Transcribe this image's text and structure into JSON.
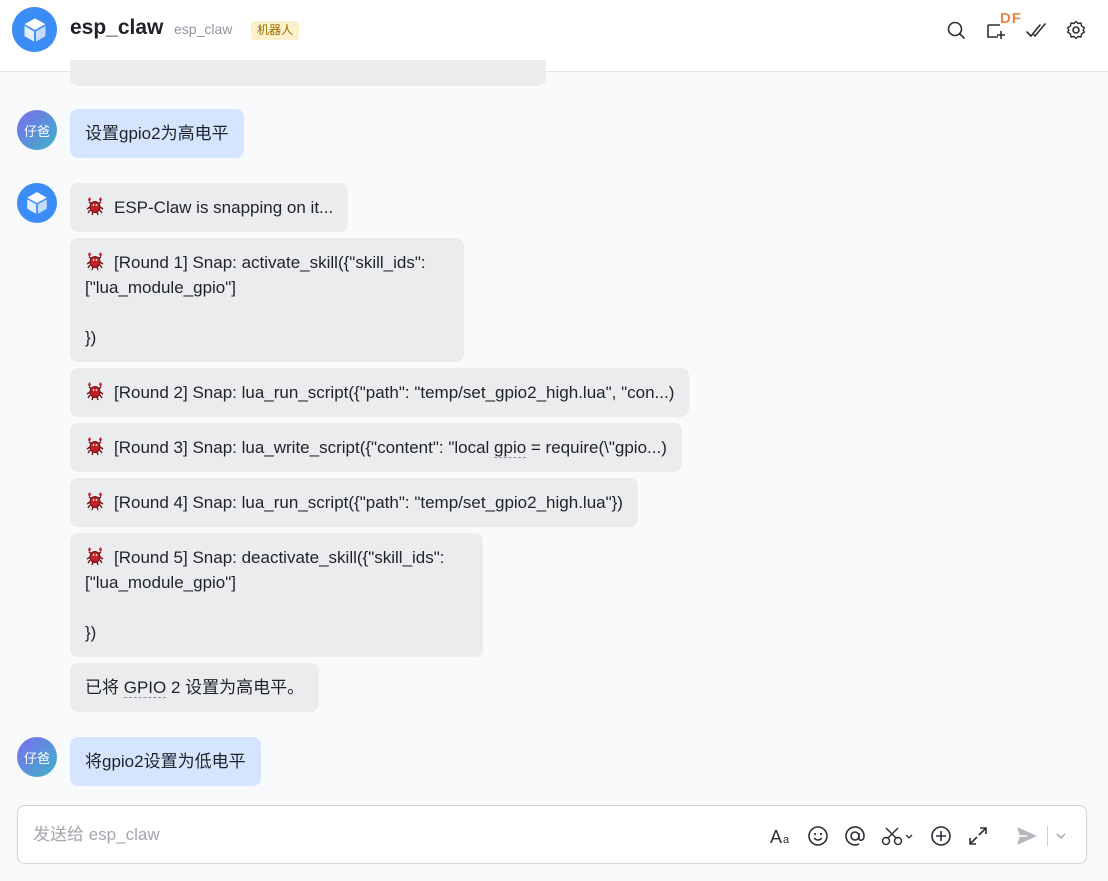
{
  "header": {
    "title": "esp_claw",
    "subtitle": "esp_claw",
    "badge": "机器人",
    "watermark": "DF",
    "icons": [
      "search-icon",
      "add-window-icon",
      "checkmark-icon",
      "settings-icon"
    ]
  },
  "user": {
    "avatar_text": "仔爸"
  },
  "messages": {
    "user_1": "设置gpio2为高电平",
    "bot_status": "ESP-Claw is snapping on it...",
    "round_1": "[Round 1] Snap: activate_skill({\"skill_ids\":\n[\"lua_module_gpio\"]\n\n})",
    "round_2": "[Round 2] Snap: lua_run_script({\"path\": \"temp/set_gpio2_high.lua\", \"con...)",
    "round_3_pre": "[Round 3] Snap: lua_write_script({\"content\": \"local ",
    "round_3_word": "gpio",
    "round_3_post": " = require(\\\"gpio...)",
    "round_4": "[Round 4] Snap: lua_run_script({\"path\": \"temp/set_gpio2_high.lua\"})",
    "round_5": "[Round 5] Snap: deactivate_skill({\"skill_ids\":\n[\"lua_module_gpio\"]\n\n})",
    "result_pre": "已将 ",
    "result_word": "GPIO",
    "result_post": " 2 设置为高电平。",
    "user_2": "将gpio2设置为低电平"
  },
  "composer": {
    "placeholder": "发送给 esp_claw",
    "tools": [
      "font-format-icon",
      "emoji-icon",
      "mention-icon",
      "scissors-icon",
      "add-icon",
      "expand-icon",
      "send-icon",
      "chevron-down-icon"
    ]
  },
  "colors": {
    "bot_bubble": "#ebeced",
    "user_bubble": "#d6e5ff",
    "accent": "#3b8cf5",
    "badge_bg": "#fdf1cc"
  }
}
